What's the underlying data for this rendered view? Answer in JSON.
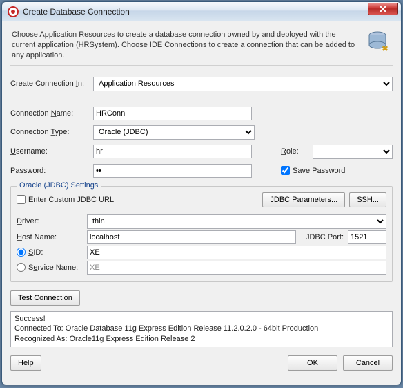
{
  "window": {
    "title": "Create Database Connection",
    "intro": "Choose Application Resources to create a database connection owned by and deployed with the current application (HRSystem). Choose IDE Connections to create a connection that can be added to any application."
  },
  "labels": {
    "createIn": "Create Connection In:",
    "createInU": "I",
    "connName": "Connection Name:",
    "connNameU": "N",
    "connType": "Connection Type:",
    "connTypeU": "T",
    "username": "Username:",
    "usernameU": "U",
    "password": "Password:",
    "passwordU": "P",
    "role": "Role:",
    "roleU": "R",
    "savePassword": "Save Password",
    "groupTitle": "Oracle (JDBC) Settings",
    "customUrl": "Enter Custom JDBC URL",
    "customUrlU": "J",
    "jdbcParams": "JDBC Parameters...",
    "ssh": "SSH...",
    "driver": "Driver:",
    "driverU": "D",
    "host": "Host Name:",
    "hostU": "H",
    "port": "JDBC Port:",
    "sid": "SID:",
    "sidU": "S",
    "service": "Service Name:",
    "serviceU": "e",
    "testConn": "Test Connection",
    "help": "Help",
    "ok": "OK",
    "cancel": "Cancel"
  },
  "values": {
    "createIn": "Application Resources",
    "connName": "HRConn",
    "connType": "Oracle (JDBC)",
    "username": "hr",
    "password": "••",
    "role": "",
    "savePassword": true,
    "customUrl": false,
    "driver": "thin",
    "host": "localhost",
    "port": "1521",
    "sidSelected": true,
    "sid": "XE",
    "service": "XE"
  },
  "result": {
    "line1": "Success!",
    "line2": "Connected To: Oracle Database 11g Express Edition Release 11.2.0.2.0 - 64bit Production",
    "line3": "Recognized As: Oracle11g Express Edition Release 2"
  }
}
